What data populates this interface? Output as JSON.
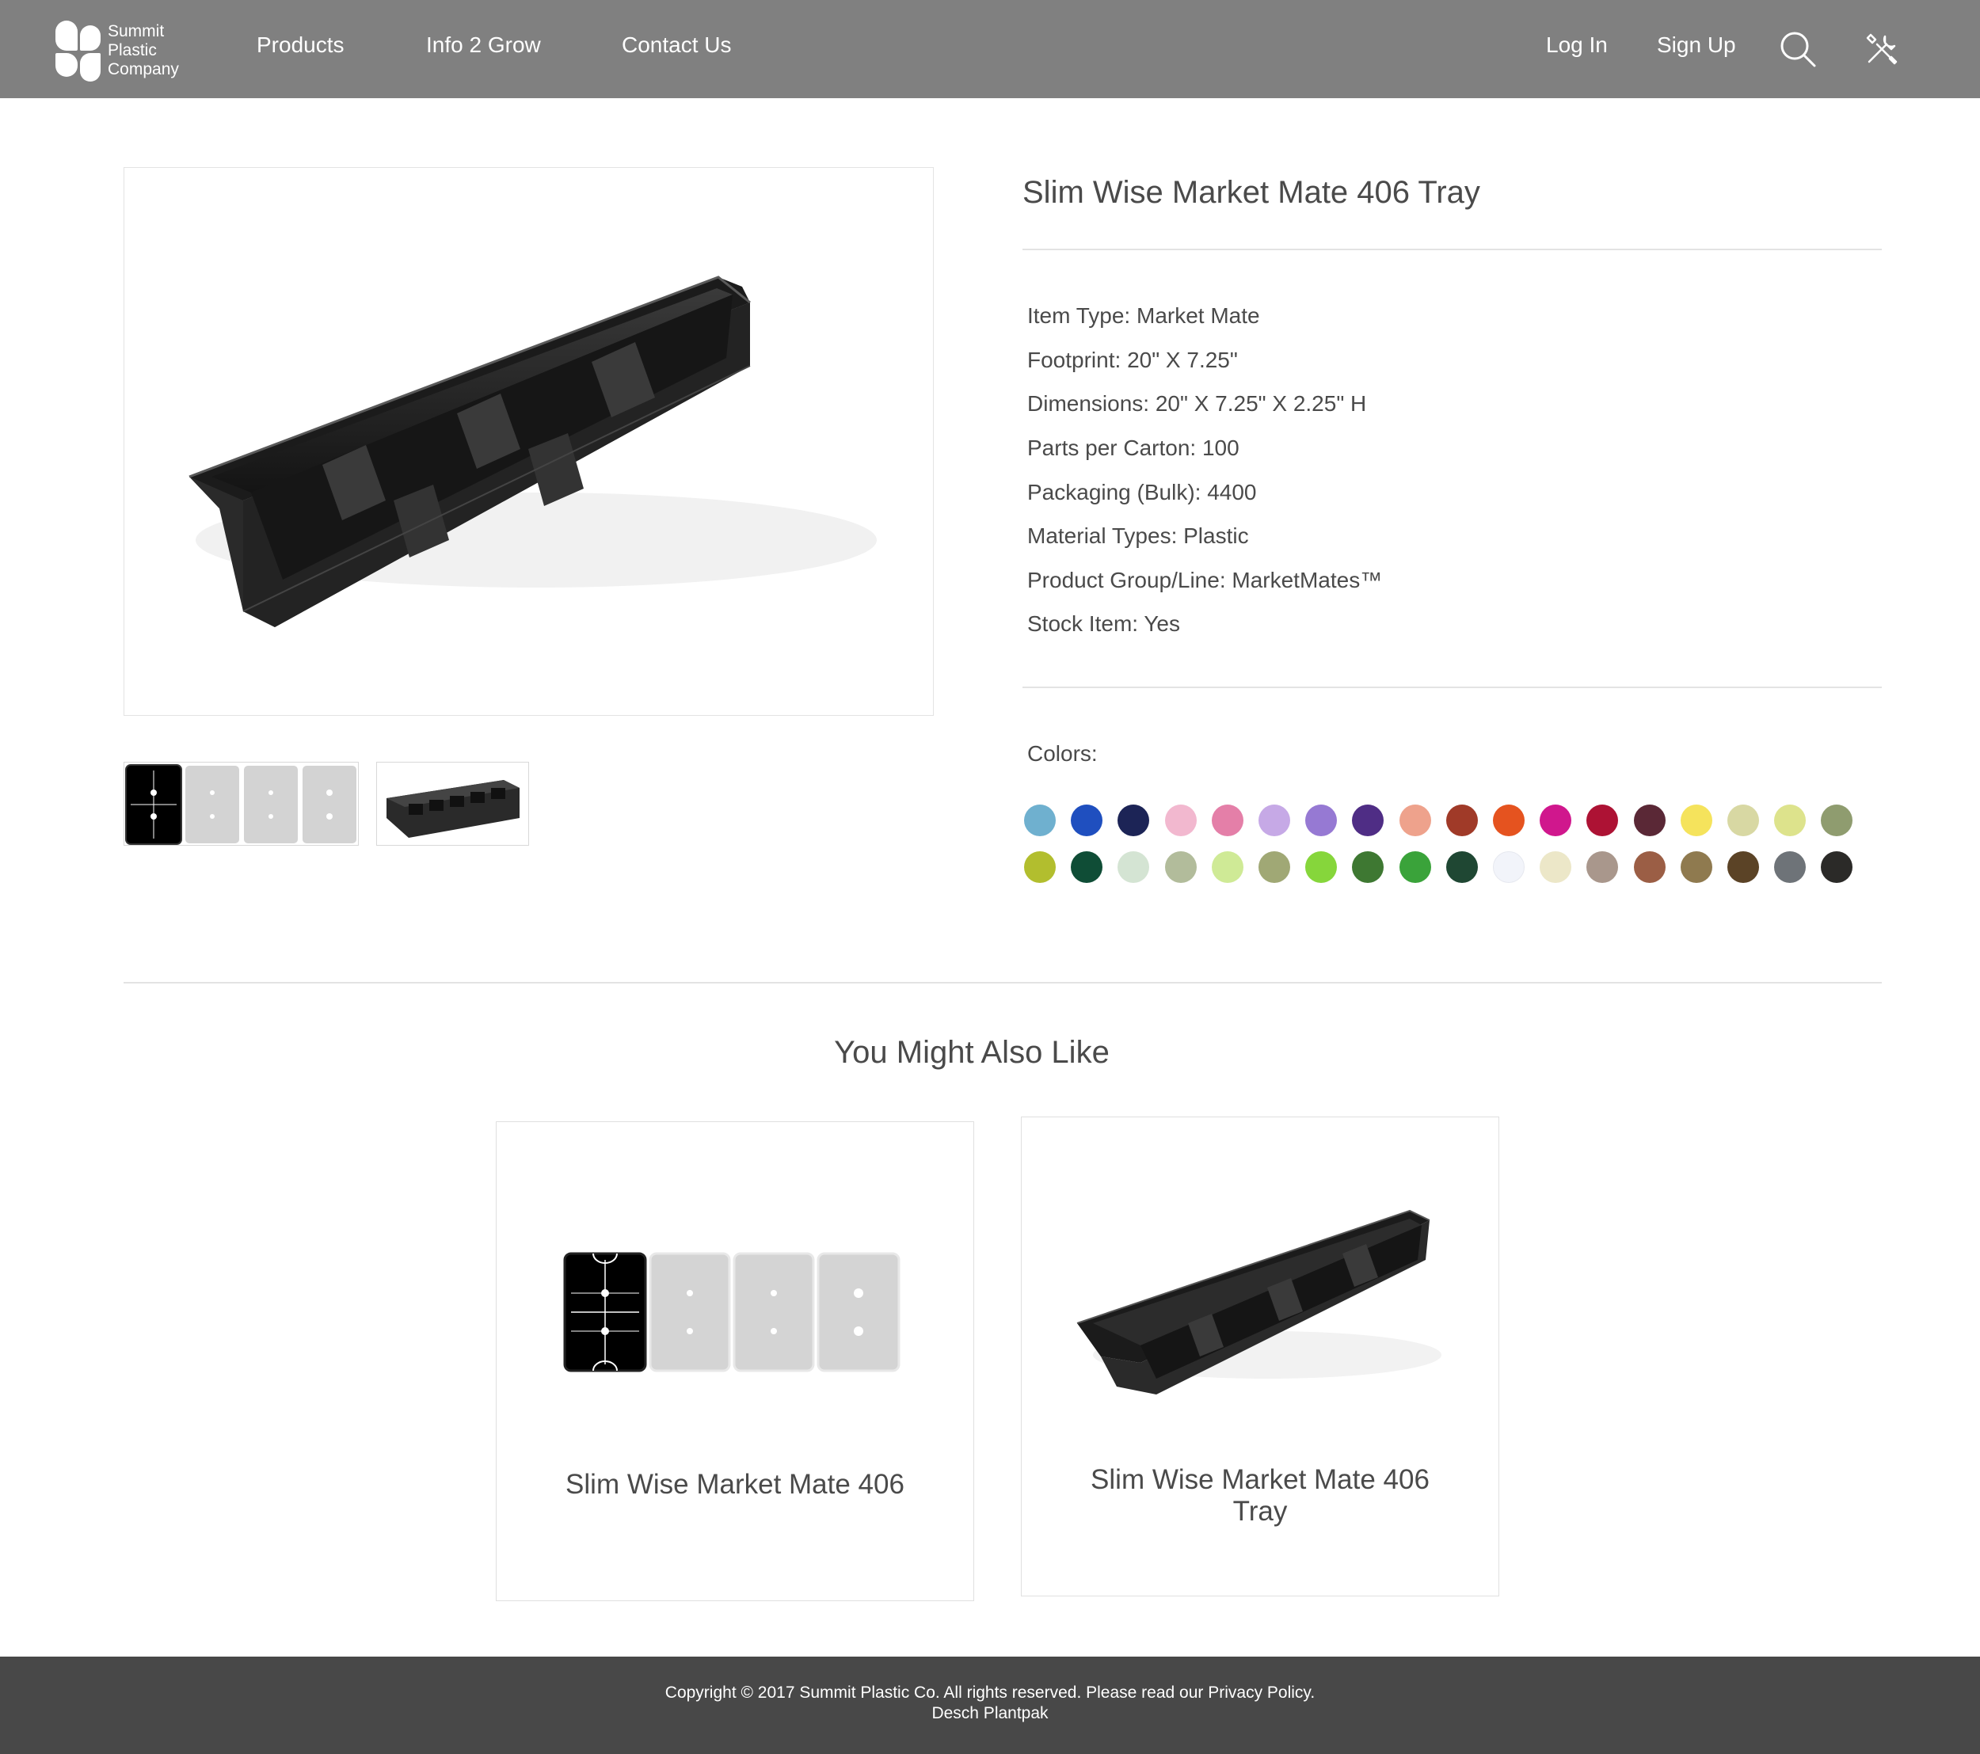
{
  "brand": {
    "line1": "Summit",
    "line2": "Plastic",
    "line3": "Company",
    "logo_icon": "leaf-logo-icon"
  },
  "nav": {
    "items": [
      {
        "label": "Products"
      },
      {
        "label": "Info 2 Grow"
      },
      {
        "label": "Contact Us"
      }
    ],
    "login": "Log In",
    "signup": "Sign Up",
    "search_icon": "search-icon",
    "tools_icon": "tools-icon"
  },
  "product": {
    "title": "Slim Wise Market Mate 406 Tray",
    "specs": [
      {
        "key": "Item Type:",
        "value": "Market Mate"
      },
      {
        "key": "Footprint:",
        "value": "20\" X 7.25\""
      },
      {
        "key": "Dimensions:",
        "value": "20\" X 7.25\" X 2.25\" H"
      },
      {
        "key": "Parts per Carton:",
        "value": "100"
      },
      {
        "key": "Packaging (Bulk):",
        "value": "4400"
      },
      {
        "key": "Material Types:",
        "value": "Plastic"
      },
      {
        "key": "Product Group/Line:",
        "value": "MarketMates™"
      },
      {
        "key": "Stock Item:",
        "value": "Yes"
      }
    ],
    "colors_label": "Colors:",
    "colors": [
      "#6fb0cf",
      "#1f4fbf",
      "#1c2456",
      "#f2b8cf",
      "#e47fa8",
      "#c6a9e6",
      "#9679d3",
      "#4f2d85",
      "#eea28c",
      "#a03a28",
      "#e5531f",
      "#d0178d",
      "#ad1234",
      "#5a2836",
      "#f5e35c",
      "#d8d8a3",
      "#dde38c",
      "#8f9c6f",
      "#b2be2e",
      "#0f4d36",
      "#d4e4d3",
      "#b2bc9b",
      "#cfea96",
      "#a0a875",
      "#86d63b",
      "#3e7832",
      "#3aa33a",
      "#1f4733",
      "#f2f4fa",
      "#ece7c8",
      "#a9978c",
      "#9b5e45",
      "#8f7a4f",
      "#5b4326",
      "#6e7378",
      "#2b2a28"
    ]
  },
  "related": {
    "heading": "You Might Also Like",
    "items": [
      {
        "title": "Slim Wise Market Mate 406"
      },
      {
        "title_line1": "Slim Wise Market Mate 406",
        "title_line2": "Tray"
      }
    ]
  },
  "footer": {
    "copyright": "Copyright © 2017 Summit Plastic Co. All rights reserved. Please read our",
    "privacy": "Privacy Policy.",
    "credit": "Desch Plantpak"
  }
}
